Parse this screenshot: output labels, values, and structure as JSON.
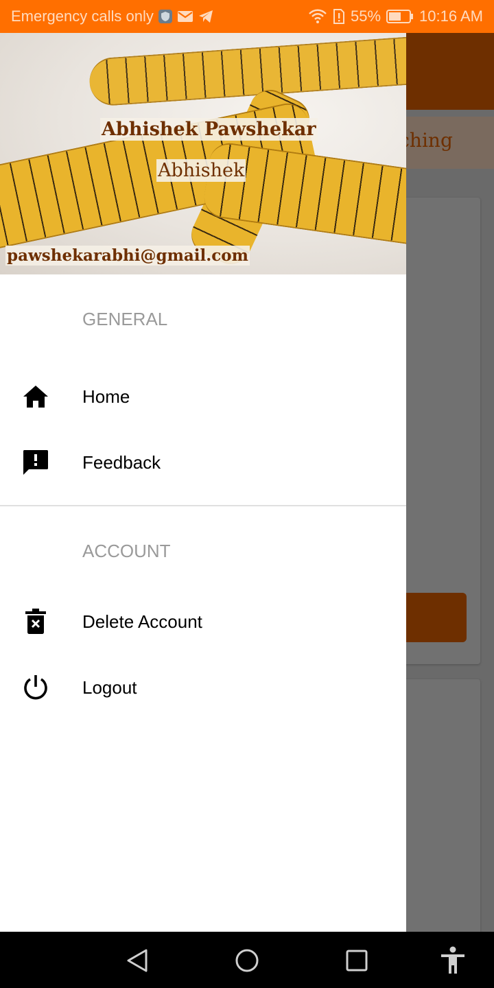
{
  "status_bar": {
    "carrier_text": "Emergency calls only",
    "battery": "55%",
    "time": "10:16 AM",
    "icons": [
      "shield-app-icon",
      "mail-icon",
      "telegram-icon",
      "wifi-icon",
      "sim-alert-icon",
      "battery-icon"
    ],
    "color": "#ff6f00"
  },
  "background_app": {
    "tab_text_partial": "tching",
    "toolbar_color": "#6e2f00"
  },
  "drawer": {
    "header": {
      "name": "Abhishek Pawshekar",
      "username": "Abhishek",
      "email": "pawshekarabhi@gmail.com",
      "background_image": "measuring-tape-image",
      "text_color": "#6e2f00"
    },
    "sections": [
      {
        "title": "GENERAL",
        "items": [
          {
            "label": "Home",
            "icon": "home-icon"
          },
          {
            "label": "Feedback",
            "icon": "feedback-icon"
          }
        ]
      },
      {
        "title": "ACCOUNT",
        "items": [
          {
            "label": "Delete Account",
            "icon": "delete-icon"
          },
          {
            "label": "Logout",
            "icon": "power-icon"
          }
        ]
      }
    ]
  },
  "nav_bar": {
    "buttons": [
      "back-icon",
      "home-circle-icon",
      "recents-icon",
      "accessibility-icon"
    ]
  }
}
